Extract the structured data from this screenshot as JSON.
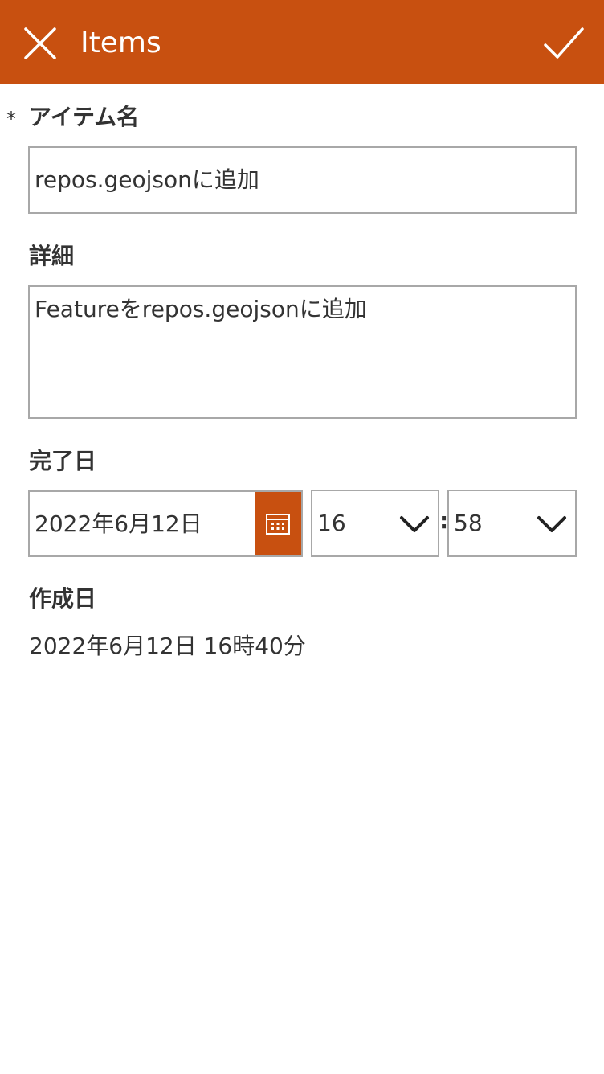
{
  "header": {
    "title": "Items",
    "close_icon": "close-icon",
    "save_icon": "checkmark-icon",
    "background_color": "#c85010"
  },
  "form": {
    "required_mark": "*",
    "title_field": {
      "label": "アイテム名",
      "value": "repos.geojsonに追加"
    },
    "details_field": {
      "label": "詳細",
      "value": "Featureをrepos.geojsonに追加"
    },
    "due_date_field": {
      "label": "完了日",
      "date_value": "2022年6月12日",
      "calendar_icon": "calendar-icon",
      "hour_value": "16",
      "time_separator": ":",
      "minute_value": "58",
      "dropdown_icon": "chevron-down-icon"
    },
    "created_field": {
      "label": "作成日",
      "value": "2022年6月12日 16時40分"
    }
  }
}
